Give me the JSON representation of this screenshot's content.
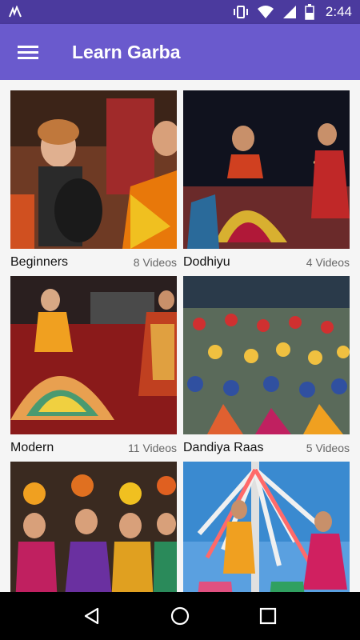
{
  "status_bar": {
    "time": "2:44",
    "icons": [
      "notification-icon",
      "vibrate-icon",
      "wifi-icon",
      "signal-icon",
      "battery-icon"
    ]
  },
  "app_bar": {
    "menu_icon": "hamburger-menu-icon",
    "title": "Learn Garba"
  },
  "categories": [
    {
      "name": "Beginners",
      "count": "8 Videos"
    },
    {
      "name": "Dodhiyu",
      "count": "4 Videos"
    },
    {
      "name": "Modern",
      "count": "11 Videos"
    },
    {
      "name": "Dandiya Raas",
      "count": "5 Videos"
    },
    {
      "name": "",
      "count": ""
    },
    {
      "name": "",
      "count": ""
    }
  ],
  "nav_bar": {
    "back_icon": "back-triangle-icon",
    "home_icon": "home-circle-icon",
    "recents_icon": "recents-square-icon"
  },
  "colors": {
    "status_bar": "#4b3a9e",
    "app_bar": "#6a5acd",
    "content_bg": "#f5f5f5",
    "nav_bar": "#000000"
  }
}
